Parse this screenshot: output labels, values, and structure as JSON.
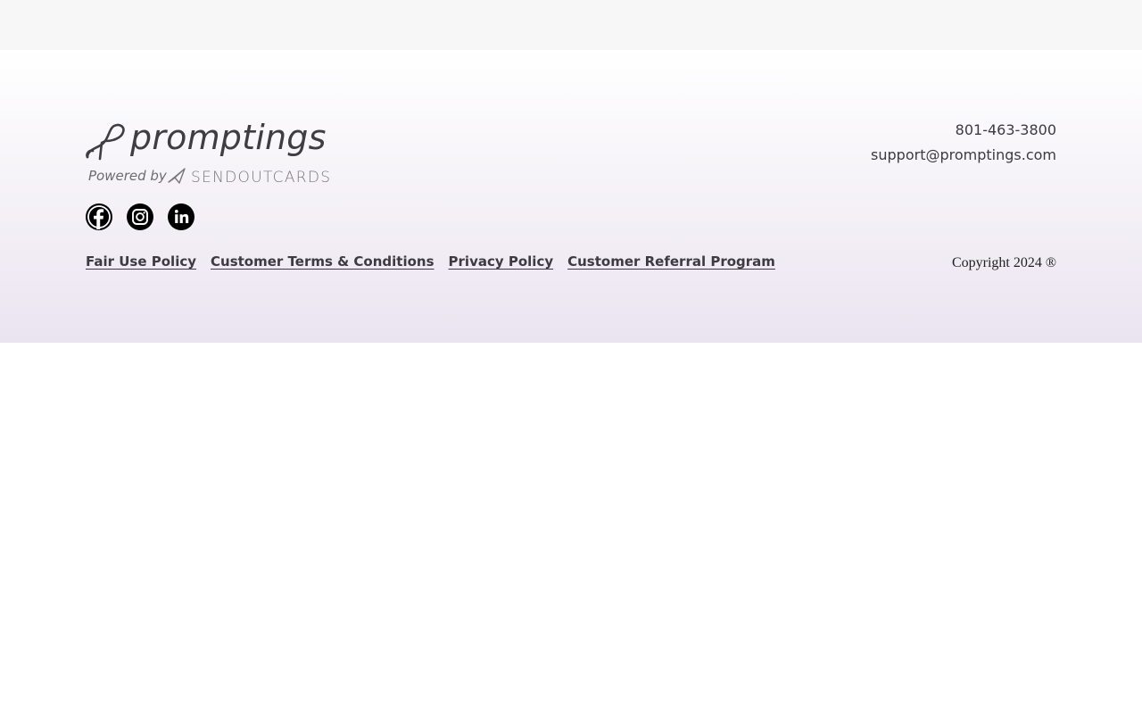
{
  "brand": {
    "name": "promptings",
    "powered_by": "Powered by",
    "partner": "SENDOUTCARDS"
  },
  "social": [
    {
      "name": "facebook",
      "icon": "facebook-icon"
    },
    {
      "name": "instagram",
      "icon": "instagram-icon"
    },
    {
      "name": "linkedin",
      "icon": "linkedin-icon"
    }
  ],
  "links": [
    {
      "label": "Fair Use Policy"
    },
    {
      "label": "Customer Terms & Conditions"
    },
    {
      "label": "Privacy Policy"
    },
    {
      "label": "Customer Referral Program"
    }
  ],
  "contact": {
    "phone": "801-463-3800",
    "email": "support@promptings.com"
  },
  "copyright": "Copyright 2024 ®",
  "colors": {
    "text": "#3d3a40",
    "gradient_top": "#ffffff",
    "gradient_bottom": "#eae4f0",
    "icon_bg": "#000000"
  }
}
